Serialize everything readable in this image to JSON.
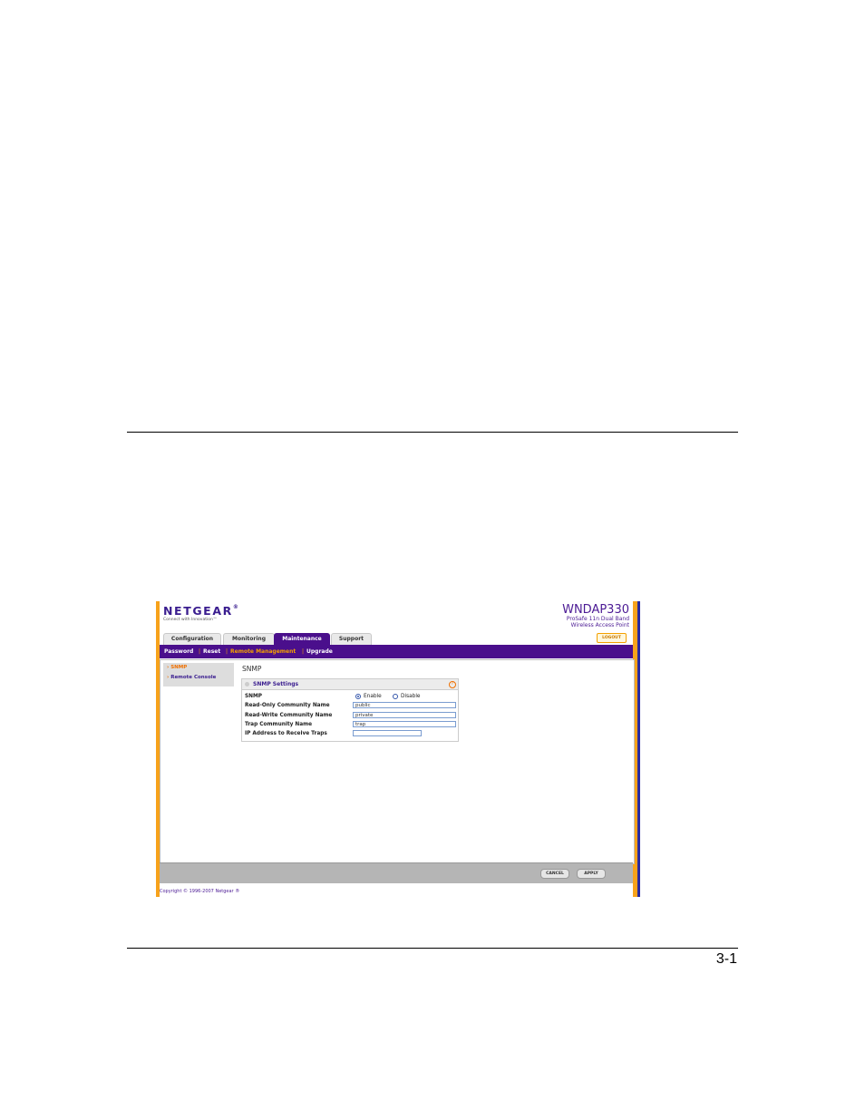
{
  "page": {
    "page_number": "3-1"
  },
  "screenshot": {
    "brand": {
      "logo": "NETGEAR",
      "trademark": "®",
      "tagline": "Connect with Innovation™"
    },
    "product": {
      "model": "WNDAP330",
      "line1": "ProSafe 11n Dual Band",
      "line2": "Wireless Access Point"
    },
    "logout_label": "LOGOUT",
    "tabs": [
      {
        "label": "Configuration"
      },
      {
        "label": "Monitoring"
      },
      {
        "label": "Maintenance"
      },
      {
        "label": "Support"
      }
    ],
    "subnav": [
      {
        "label": "Password"
      },
      {
        "label": "Reset"
      },
      {
        "label": "Remote Management"
      },
      {
        "label": "Upgrade"
      }
    ],
    "sidebar": [
      {
        "label": "SNMP"
      },
      {
        "label": "Remote Console"
      }
    ],
    "content_title": "SNMP",
    "settings": {
      "title": "SNMP Settings",
      "help": "?",
      "snmp_label": "SNMP",
      "enable_label": "Enable",
      "disable_label": "Disable",
      "selected": "Enable",
      "fields": [
        {
          "label": "Read-Only Community Name",
          "value": "public"
        },
        {
          "label": "Read-Write Community Name",
          "value": "private"
        },
        {
          "label": "Trap Community Name",
          "value": "trap"
        },
        {
          "label": "IP Address to Receive Traps",
          "value": ""
        }
      ]
    },
    "buttons": {
      "cancel": "CANCEL",
      "apply": "APPLY"
    },
    "copyright": "Copyright © 1996-2007 Netgear ®",
    "colors": {
      "purple": "#4a0f8c",
      "orange": "#f7a21b",
      "grey_bar": "#b5b5b5"
    }
  }
}
